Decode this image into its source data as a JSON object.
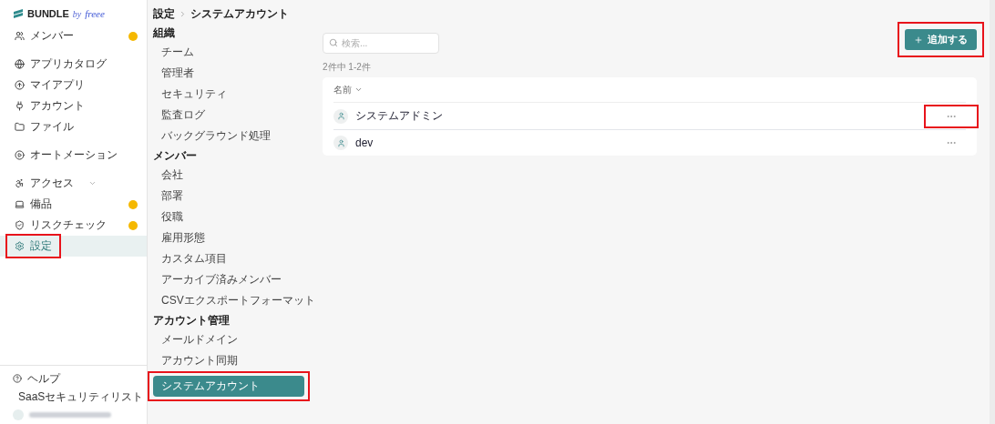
{
  "logo": {
    "brand": "BUNDLE",
    "by": "by",
    "partner": "freee"
  },
  "sidebar": {
    "groups": [
      [
        {
          "label": "メンバー",
          "alert": true,
          "selected": false,
          "annotated": false
        }
      ],
      [
        {
          "label": "アプリカタログ",
          "alert": false,
          "selected": false,
          "annotated": false
        },
        {
          "label": "マイアプリ",
          "alert": false,
          "selected": false,
          "annotated": false
        },
        {
          "label": "アカウント",
          "alert": false,
          "selected": false,
          "annotated": false
        },
        {
          "label": "ファイル",
          "alert": false,
          "selected": false,
          "annotated": false
        }
      ],
      [
        {
          "label": "オートメーション",
          "alert": false,
          "selected": false,
          "annotated": false
        }
      ],
      [
        {
          "label": "アクセス",
          "alert": false,
          "has_submenu": true,
          "selected": false,
          "annotated": false
        },
        {
          "label": "備品",
          "alert": true,
          "selected": false,
          "annotated": false
        },
        {
          "label": "リスクチェック",
          "alert": true,
          "selected": false,
          "annotated": false
        },
        {
          "label": "設定",
          "alert": false,
          "selected": true,
          "annotated": true
        }
      ]
    ],
    "footer": [
      {
        "label": "ヘルプ"
      },
      {
        "label": "SaaSセキュリティリスト"
      }
    ]
  },
  "breadcrumb": [
    "設定",
    "システムアカウント"
  ],
  "settings_nav": [
    {
      "title": "組織",
      "items": [
        {
          "label": "チーム",
          "selected": false
        },
        {
          "label": "管理者",
          "selected": false
        },
        {
          "label": "セキュリティ",
          "selected": false
        },
        {
          "label": "監査ログ",
          "selected": false
        },
        {
          "label": "バックグラウンド処理",
          "selected": false
        }
      ]
    },
    {
      "title": "メンバー",
      "items": [
        {
          "label": "会社",
          "selected": false
        },
        {
          "label": "部署",
          "selected": false
        },
        {
          "label": "役職",
          "selected": false
        },
        {
          "label": "雇用形態",
          "selected": false
        },
        {
          "label": "カスタム項目",
          "selected": false
        },
        {
          "label": "アーカイブ済みメンバー",
          "selected": false
        },
        {
          "label": "CSVエクスポートフォーマット",
          "selected": false
        }
      ]
    },
    {
      "title": "アカウント管理",
      "items": [
        {
          "label": "メールドメイン",
          "selected": false
        },
        {
          "label": "アカウント同期",
          "selected": false
        },
        {
          "label": "システムアカウント",
          "selected": true,
          "annotated": true
        }
      ]
    }
  ],
  "search": {
    "placeholder": "検索..."
  },
  "add_button": {
    "label": "追加する",
    "annotated": true
  },
  "count": "2件中 1-2件",
  "table": {
    "columns": [
      "名前"
    ],
    "rows": [
      {
        "name": "システムアドミン",
        "annotated": true
      },
      {
        "name": "dev",
        "annotated": false
      }
    ]
  }
}
